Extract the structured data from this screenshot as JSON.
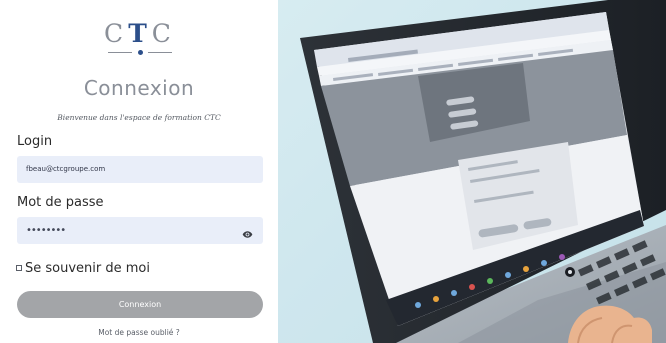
{
  "brand": {
    "logo_text_left": "C",
    "logo_text_mid": "T",
    "logo_text_right": "C"
  },
  "page": {
    "title": "Connexion",
    "subtitle": "Bienvenue dans l'espace de formation CTC"
  },
  "form": {
    "login_label": "Login",
    "login_value": "fbeau@ctcgroupe.com",
    "password_label": "Mot de passe",
    "password_value": "••••••••",
    "remember_label": "Se souvenir de moi",
    "remember_checked": false,
    "submit_label": "Connexion",
    "forgot_label": "Mot de passe oublié ?"
  },
  "icons": {
    "eye": "eye-icon",
    "checkbox": "checkbox-icon"
  },
  "colors": {
    "input_bg": "#e9eef9",
    "button_bg": "#a3a5a8",
    "logo_accent": "#2c4f8a",
    "logo_grey": "#8a8f98",
    "photo_bg": "#cfe7ee"
  }
}
